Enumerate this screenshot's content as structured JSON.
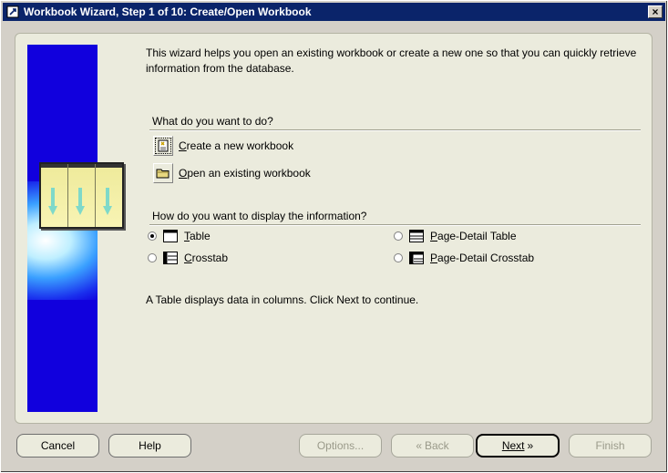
{
  "window": {
    "title": "Workbook Wizard, Step 1 of 10: Create/Open Workbook",
    "close": "×"
  },
  "intro": "This wizard helps you open an existing workbook or create a new one so that you can quickly retrieve information from the database.",
  "section1": {
    "label": "What do you want to do?",
    "create": {
      "first": "C",
      "rest": "reate a new workbook"
    },
    "open": {
      "first": "O",
      "rest": "pen an existing workbook"
    }
  },
  "section2": {
    "label": "How do you want to display the information?",
    "options": {
      "table": {
        "first": "T",
        "rest": "able",
        "selected": true
      },
      "crosstab": {
        "first": "C",
        "rest": "rosstab",
        "selected": false
      },
      "page_detail_table": {
        "first": "P",
        "rest": "age-Detail Table",
        "selected": false
      },
      "page_detail_crosstab": {
        "first": "P",
        "rest": "age-Detail Crosstab",
        "selected": false
      }
    }
  },
  "description": "A Table displays data in columns. Click Next to continue.",
  "buttons": {
    "cancel": "Cancel",
    "help": "Help",
    "options": "Options...",
    "back": "Back",
    "next": "Next",
    "finish": "Finish"
  }
}
